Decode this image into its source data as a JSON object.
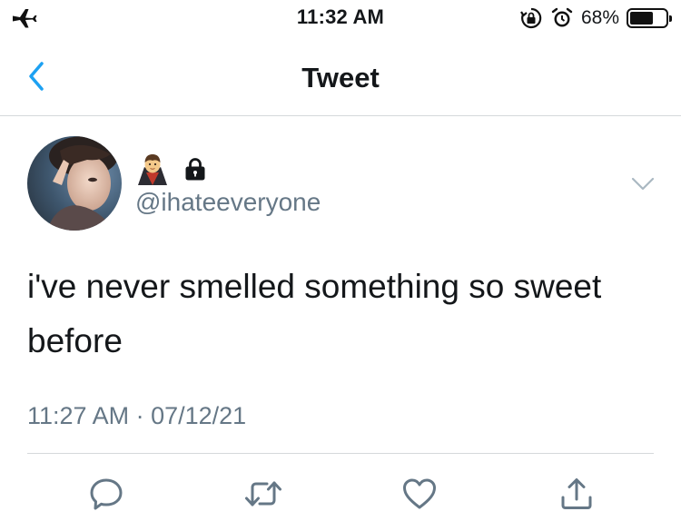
{
  "status_bar": {
    "time": "11:32 AM",
    "battery_percent": "68%",
    "battery_level": 0.68,
    "icons": [
      "airplane-icon",
      "rotation-lock-icon",
      "alarm-icon",
      "battery-icon"
    ]
  },
  "nav": {
    "title": "Tweet",
    "back_icon": "chevron-left-icon"
  },
  "tweet": {
    "name_emojis": [
      "vampire-emoji",
      "lock-icon"
    ],
    "handle": "@ihateeveryone",
    "text": "i've never smelled something so sweet before",
    "timestamp": "11:27 AM · 07/12/21"
  },
  "actions": [
    {
      "icon": "reply-icon"
    },
    {
      "icon": "retweet-icon"
    },
    {
      "icon": "like-icon"
    },
    {
      "icon": "share-icon"
    }
  ],
  "colors": {
    "accent": "#1da1f2",
    "secondary_text": "#657786",
    "primary_text": "#14171a",
    "divider": "#d5d8db"
  }
}
